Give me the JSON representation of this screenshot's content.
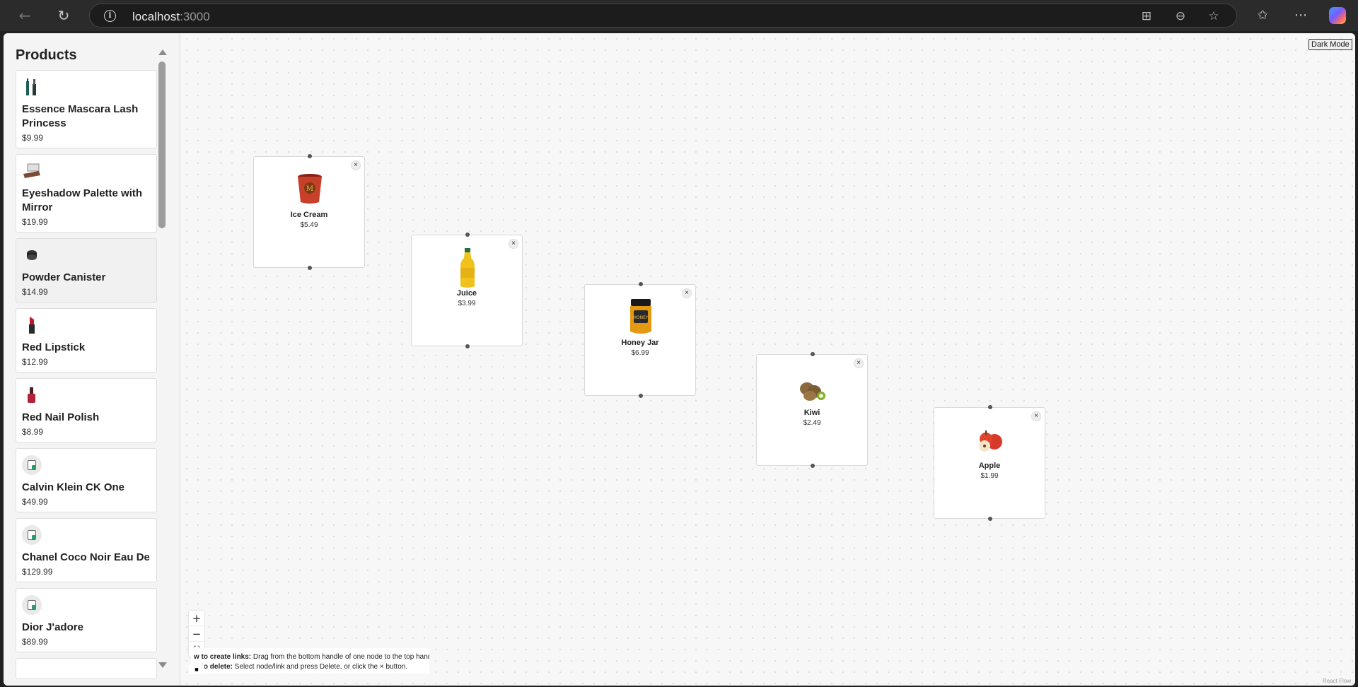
{
  "browser": {
    "url_host": "localhost",
    "url_port": ":3000",
    "back_icon": "arrow-left-icon",
    "refresh_icon": "refresh-icon"
  },
  "sidebar": {
    "title": "Products",
    "products": [
      {
        "name": "Essence Mascara Lash Princess",
        "price": "$9.99",
        "icon": "mascara-icon",
        "bg": "white"
      },
      {
        "name": "Eyeshadow Palette with Mirror",
        "price": "$19.99",
        "icon": "palette-icon",
        "bg": "white"
      },
      {
        "name": "Powder Canister",
        "price": "$14.99",
        "icon": "powder-icon",
        "bg": "gray"
      },
      {
        "name": "Red Lipstick",
        "price": "$12.99",
        "icon": "lipstick-icon",
        "bg": "white"
      },
      {
        "name": "Red Nail Polish",
        "price": "$8.99",
        "icon": "nail-polish-icon",
        "bg": "white"
      },
      {
        "name": "Calvin Klein CK One",
        "price": "$49.99",
        "icon": "perfume-placeholder-icon",
        "bg": "white"
      },
      {
        "name": "Chanel Coco Noir Eau De",
        "price": "$129.99",
        "icon": "perfume-placeholder-icon",
        "bg": "white"
      },
      {
        "name": "Dior J'adore",
        "price": "$89.99",
        "icon": "perfume-placeholder-icon",
        "bg": "white"
      }
    ]
  },
  "canvas": {
    "dark_mode_label": "Dark Mode",
    "nodes": [
      {
        "name": "Ice Cream",
        "price": "$5.49",
        "icon": "ice-cream-icon",
        "close": "×"
      },
      {
        "name": "Juice",
        "price": "$3.99",
        "icon": "juice-icon",
        "close": "×"
      },
      {
        "name": "Honey Jar",
        "price": "$6.99",
        "icon": "honey-jar-icon",
        "close": "×"
      },
      {
        "name": "Kiwi",
        "price": "$2.49",
        "icon": "kiwi-icon",
        "close": "×"
      },
      {
        "name": "Apple",
        "price": "$1.99",
        "icon": "apple-icon",
        "close": "×"
      }
    ],
    "controls": {
      "zoom_in": "+",
      "zoom_out": "−",
      "fit": "⛶",
      "lock": "🔒"
    },
    "help": {
      "links_label": "w to create links:",
      "links_text": " Drag from the bottom handle of one node to the top handle of another.",
      "delete_label": "w to delete:",
      "delete_text": " Select node/link and press Delete, or click the × button."
    },
    "attribution": "React Flow"
  }
}
